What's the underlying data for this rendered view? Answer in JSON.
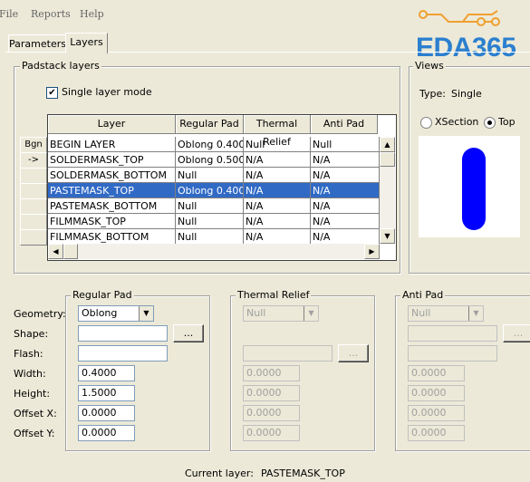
{
  "menu": [
    "File",
    "Reports",
    "Help"
  ],
  "logo": {
    "text": "EDA365",
    "color": "#2b7fcf"
  },
  "tabs": [
    {
      "label": "Parameters",
      "active": false
    },
    {
      "label": "Layers",
      "active": true
    }
  ],
  "padstack": {
    "group_title": "Padstack layers",
    "single_layer_mode": {
      "label": "Single layer mode",
      "checked": true
    },
    "columns": [
      "Layer",
      "Regular Pad",
      "Thermal Relief",
      "Anti Pad"
    ],
    "row_buttons": [
      "Bgn",
      "->",
      "",
      "",
      "",
      "",
      ""
    ],
    "rows": [
      {
        "layer": "BEGIN LAYER",
        "regular": "Oblong 0.4000",
        "thermal": "Null",
        "anti": "Null",
        "selected": false
      },
      {
        "layer": "SOLDERMASK_TOP",
        "regular": "Oblong 0.5000",
        "thermal": "N/A",
        "anti": "N/A",
        "selected": false
      },
      {
        "layer": "SOLDERMASK_BOTTOM",
        "regular": "Null",
        "thermal": "N/A",
        "anti": "N/A",
        "selected": false
      },
      {
        "layer": "PASTEMASK_TOP",
        "regular": "Oblong 0.4000",
        "thermal": "N/A",
        "anti": "N/A",
        "selected": true
      },
      {
        "layer": "PASTEMASK_BOTTOM",
        "regular": "Null",
        "thermal": "N/A",
        "anti": "N/A",
        "selected": false
      },
      {
        "layer": "FILMMASK_TOP",
        "regular": "Null",
        "thermal": "N/A",
        "anti": "N/A",
        "selected": false
      },
      {
        "layer": "FILMMASK_BOTTOM",
        "regular": "Null",
        "thermal": "N/A",
        "anti": "N/A",
        "selected": false
      }
    ]
  },
  "views": {
    "group_title": "Views",
    "type_label": "Type:",
    "type_value": "Single",
    "xsection_label": "XSection",
    "top_label": "Top",
    "selected": "Top",
    "pad_color": "#0000ff"
  },
  "params": {
    "labels": {
      "geometry": "Geometry:",
      "shape": "Shape:",
      "flash": "Flash:",
      "width": "Width:",
      "height": "Height:",
      "offset_x": "Offset X:",
      "offset_y": "Offset Y:"
    },
    "regular": {
      "title": "Regular Pad",
      "geometry": "Oblong",
      "shape": "",
      "flash": "",
      "width": "0.4000",
      "height": "1.5000",
      "offset_x": "0.0000",
      "offset_y": "0.0000",
      "browse": "..."
    },
    "thermal": {
      "title": "Thermal Relief",
      "geometry": "Null",
      "flash": "",
      "width": "0.0000",
      "height": "0.0000",
      "offset_x": "0.0000",
      "offset_y": "0.0000",
      "browse": "..."
    },
    "anti": {
      "title": "Anti Pad",
      "geometry": "Null",
      "shape": "",
      "flash": "",
      "width": "0.0000",
      "height": "0.0000",
      "offset_x": "0.0000",
      "offset_y": "0.0000",
      "browse": "..."
    }
  },
  "status": {
    "label": "Current layer:",
    "value": "PASTEMASK_TOP"
  },
  "colors": {
    "selection": "#316ac5",
    "background": "#ece9d8"
  }
}
